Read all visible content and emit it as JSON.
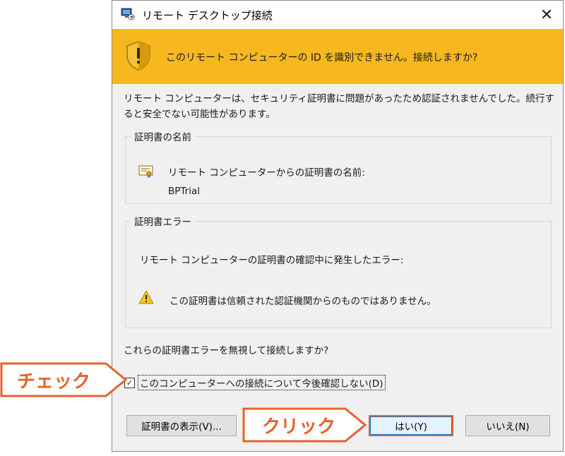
{
  "window": {
    "title": "リモート デスクトップ接続",
    "close_glyph": "✕"
  },
  "banner": {
    "message": "このリモート コンピューターの ID を識別できません。接続しますか?"
  },
  "description": "リモート コンピューターは、セキュリティ証明書に問題があったため認証されませんでした。続行すると安全でない可能性があります。",
  "cert_name_group": {
    "legend": "証明書の名前",
    "label": "リモート コンピューターからの証明書の名前:",
    "value": "BPTrial"
  },
  "cert_error_group": {
    "legend": "証明書エラー",
    "label": "リモート コンピューターの証明書の確認中に発生したエラー:",
    "error": "この証明書は信頼された認証機関からのものではありません。"
  },
  "question": "これらの証明書エラーを無視して接続しますか?",
  "checkbox": {
    "label": "このコンピューターへの接続について今後確認しない(D)",
    "checked": true,
    "check_glyph": "✓"
  },
  "buttons": {
    "view_cert": "証明書の表示(V)...",
    "yes": "はい(Y)",
    "no": "いいえ(N)"
  },
  "annotations": {
    "check_callout": "チェック",
    "click_callout": "クリック",
    "accent_color": "#e8612c"
  },
  "colors": {
    "banner": "#f6b81e",
    "dialog_bg": "#f0f0f0"
  }
}
